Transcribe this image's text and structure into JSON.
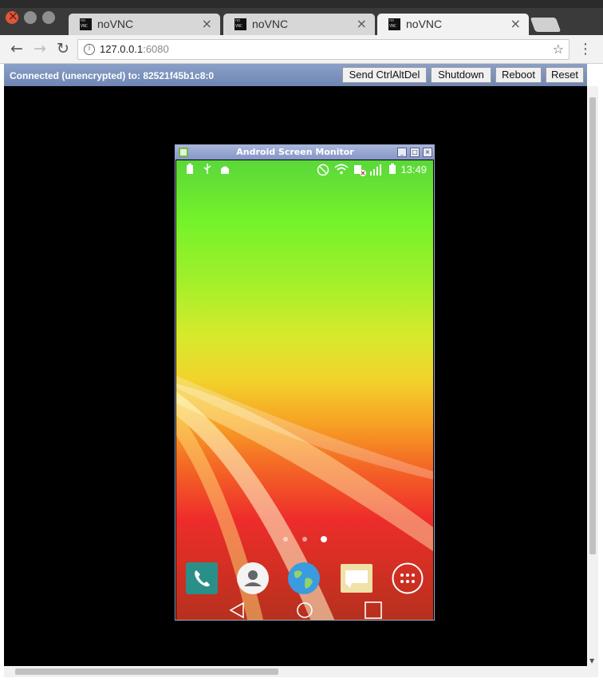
{
  "browser": {
    "tabs": [
      {
        "title": "noVNC",
        "favicon": "novnc-favicon",
        "active": false
      },
      {
        "title": "noVNC",
        "favicon": "novnc-favicon",
        "active": false
      },
      {
        "title": "noVNC",
        "favicon": "novnc-favicon",
        "active": true
      }
    ],
    "favicon_text": {
      "top": "no",
      "bottom": "VNC"
    },
    "tab_close_glyph": "×",
    "address": {
      "host": "127.0.0.1",
      "port": ":6080"
    },
    "icons": {
      "back": "back-arrow-icon",
      "forward": "forward-arrow-icon",
      "reload": "reload-icon",
      "info": "info-icon",
      "bookmark": "star-icon",
      "menu": "kebab-menu-icon"
    }
  },
  "vnc": {
    "status": "Connected (unencrypted) to: 82521f45b1c8:0",
    "buttons": {
      "ctrlaltdel": "Send CtrlAltDel",
      "shutdown": "Shutdown",
      "reboot": "Reboot",
      "reset": "Reset"
    }
  },
  "asm": {
    "title": "Android Screen Monitor",
    "controls": {
      "minimize": "_",
      "maximize": "□",
      "close": "×"
    }
  },
  "android": {
    "status_icons_left": [
      "battery-icon",
      "usb-icon",
      "android-debug-icon"
    ],
    "status_icons_right": [
      "mute-icon",
      "wifi-icon",
      "data-x-icon",
      "signal-icon",
      "battery-icon"
    ],
    "clock": "13:49",
    "pages": {
      "count": 3,
      "active": 2
    },
    "dock": [
      "phone-app-icon",
      "contacts-app-icon",
      "browser-globe-icon",
      "messaging-app-icon",
      "app-drawer-icon"
    ],
    "nav": [
      "back-key-icon",
      "home-key-icon",
      "recents-key-icon"
    ],
    "colors": {
      "phone": "#2a8f88",
      "contacts_bg": "#f3f3f3",
      "globe": "#3a9be0",
      "messaging": "#efe1a8"
    }
  }
}
